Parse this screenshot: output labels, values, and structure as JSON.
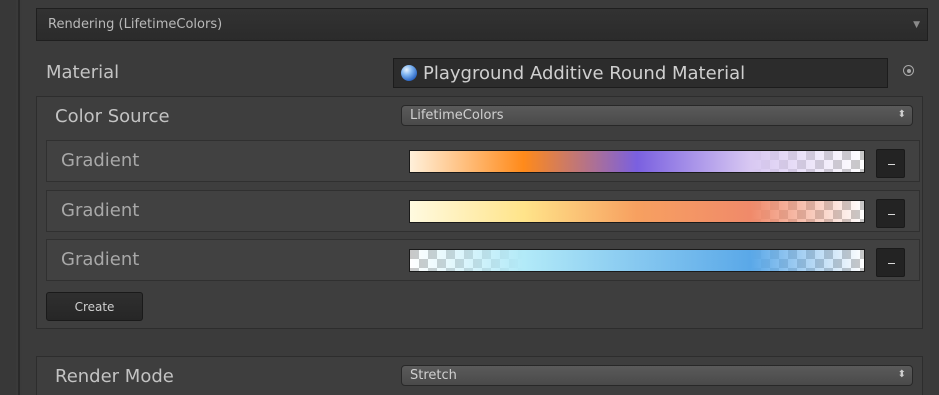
{
  "section": {
    "title": "Rendering (LifetimeColors)"
  },
  "material": {
    "label": "Material",
    "value": "Playground Additive Round Material"
  },
  "color_source": {
    "label": "Color Source",
    "value": "LifetimeColors"
  },
  "gradients": [
    {
      "label": "Gradient",
      "stops": [
        "#fff0da",
        "#ff8a1a",
        "#7a60e0",
        "#d8c8f2",
        "rgba(255,255,255,0)"
      ]
    },
    {
      "label": "Gradient",
      "stops": [
        "#fffae0",
        "#ffe48a",
        "#f7a060",
        "#f08a6a",
        "rgba(255,255,255,0)"
      ]
    },
    {
      "label": "Gradient",
      "stops": [
        "rgba(255,255,255,0)",
        "#b2eaf8",
        "#86c8f0",
        "#5aa8e8",
        "rgba(255,255,255,0)"
      ]
    }
  ],
  "remove_label": "–",
  "create_label": "Create",
  "render_mode": {
    "label": "Render Mode",
    "value": "Stretch"
  }
}
